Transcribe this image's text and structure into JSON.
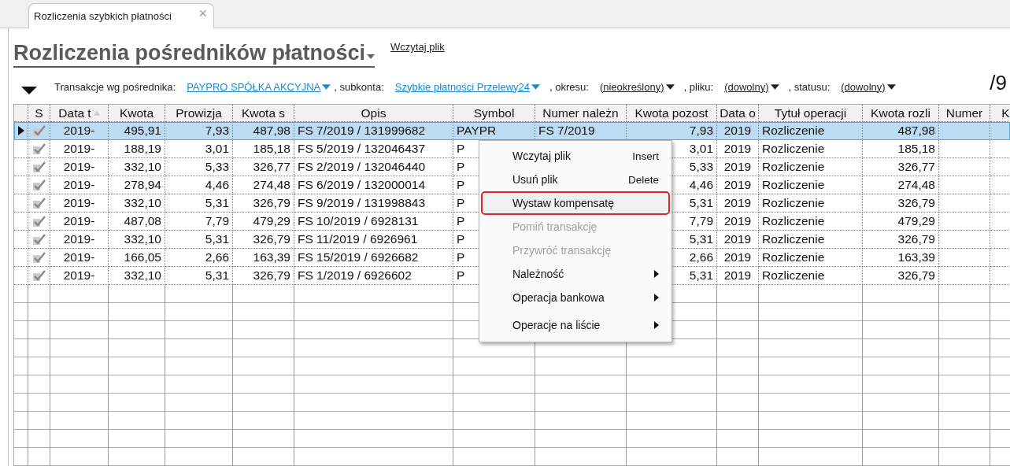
{
  "tabs": [
    {
      "label": "Rozliczenia szybkich płatności",
      "selected": true,
      "close": "×"
    }
  ],
  "header": {
    "title": "Rozliczenia pośredników płatności",
    "action_link": "Wczytaj plik",
    "counter": "/9"
  },
  "filters": [
    {
      "label": "Transakcje wg pośrednika:",
      "value": "PAYPRO SPÓŁKA AKCYJNA",
      "kind": "link"
    },
    {
      "label": ", subkonta:",
      "value": "Szybkie płatności Przelewy24",
      "kind": "link"
    },
    {
      "label": ", okresu:",
      "value": "(nieokreślony)",
      "kind": "plain"
    },
    {
      "label": ", pliku:",
      "value": "(dowolny)",
      "kind": "plain"
    },
    {
      "label": ", statusu:",
      "value": "(dowolny)",
      "kind": "plain"
    }
  ],
  "table": {
    "columns": [
      {
        "label": "S",
        "sorted": false
      },
      {
        "label": "Data t",
        "sorted": true
      },
      {
        "label": "Kwota",
        "sorted": false
      },
      {
        "label": "Prowizja",
        "sorted": false
      },
      {
        "label": "Kwota s",
        "sorted": false
      },
      {
        "label": "Opis",
        "sorted": false
      },
      {
        "label": "Symbol",
        "sorted": false
      },
      {
        "label": "Numer należn",
        "sorted": false
      },
      {
        "label": "Kwota pozost",
        "sorted": false
      },
      {
        "label": "Data o",
        "sorted": false
      },
      {
        "label": "Tytuł operacji",
        "sorted": false
      },
      {
        "label": "Kwota rozli",
        "sorted": false
      },
      {
        "label": "Numer",
        "sorted": false
      },
      {
        "label": "K",
        "sorted": false
      }
    ],
    "rows": [
      {
        "selected": true,
        "checked": true,
        "cells": [
          "",
          "2019-",
          "495,91",
          "7,93",
          "487,98",
          "FS 7/2019 / 131999682",
          "PAYPR",
          "FS 7/2019",
          "7,93",
          "2019",
          "Rozliczenie",
          "487,98"
        ]
      },
      {
        "selected": false,
        "checked": true,
        "cells": [
          "",
          "2019-",
          "188,19",
          "3,01",
          "185,18",
          "FS 5/2019 / 132046437",
          "P",
          "",
          "3,01",
          "2019",
          "Rozliczenie",
          "185,18"
        ]
      },
      {
        "selected": false,
        "checked": true,
        "cells": [
          "",
          "2019-",
          "332,10",
          "5,33",
          "326,77",
          "FS 2/2019 / 132046440",
          "P",
          "",
          "5,33",
          "2019",
          "Rozliczenie",
          "326,77"
        ]
      },
      {
        "selected": false,
        "checked": true,
        "cells": [
          "",
          "2019-",
          "278,94",
          "4,46",
          "274,48",
          "FS 6/2019 / 132000014",
          "P",
          "",
          "4,46",
          "2019",
          "Rozliczenie",
          "274,48"
        ]
      },
      {
        "selected": false,
        "checked": true,
        "cells": [
          "",
          "2019-",
          "332,10",
          "5,31",
          "326,79",
          "FS 9/2019 / 131998843",
          "P",
          "",
          "5,31",
          "2019",
          "Rozliczenie",
          "326,79"
        ]
      },
      {
        "selected": false,
        "checked": true,
        "cells": [
          "",
          "2019-",
          "487,08",
          "7,79",
          "479,29",
          "FS 10/2019 / 6928131",
          "P",
          "",
          "7,79",
          "2019",
          "Rozliczenie",
          "479,29"
        ]
      },
      {
        "selected": false,
        "checked": true,
        "cells": [
          "",
          "2019-",
          "332,10",
          "5,31",
          "326,79",
          "FS 11/2019 / 6926961",
          "P",
          "",
          "5,31",
          "2019",
          "Rozliczenie",
          "326,79"
        ]
      },
      {
        "selected": false,
        "checked": true,
        "cells": [
          "",
          "2019-",
          "166,05",
          "2,66",
          "163,39",
          "FS 15/2019 / 6926682",
          "P",
          "",
          "2,66",
          "2019",
          "Rozliczenie",
          "163,39"
        ]
      },
      {
        "selected": false,
        "checked": true,
        "cells": [
          "",
          "2019-",
          "332,10",
          "5,31",
          "326,79",
          "FS 1/2019 / 6926602",
          "P",
          "",
          "5,31",
          "2019",
          "Rozliczenie",
          "326,79"
        ]
      }
    ]
  },
  "context_menu": {
    "items": [
      {
        "label": "Wczytaj plik",
        "shortcut": "Insert",
        "disabled": false,
        "submenu": false,
        "highlighted": false
      },
      {
        "label": "Usuń plik",
        "shortcut": "Delete",
        "disabled": false,
        "submenu": false,
        "highlighted": false
      },
      {
        "label": "Wystaw kompensatę",
        "disabled": false,
        "submenu": false,
        "highlighted": true
      },
      {
        "label": "Pomiń transakcję",
        "disabled": true,
        "submenu": false,
        "highlighted": false
      },
      {
        "label": "Przywróć transakcję",
        "disabled": true,
        "submenu": false,
        "highlighted": false
      },
      {
        "label": "Należność",
        "disabled": false,
        "submenu": true,
        "highlighted": false
      },
      {
        "label": "Operacja bankowa",
        "disabled": false,
        "submenu": true,
        "highlighted": false
      },
      {
        "label": "Operacje na liście",
        "disabled": false,
        "submenu": true,
        "highlighted": false
      }
    ]
  }
}
